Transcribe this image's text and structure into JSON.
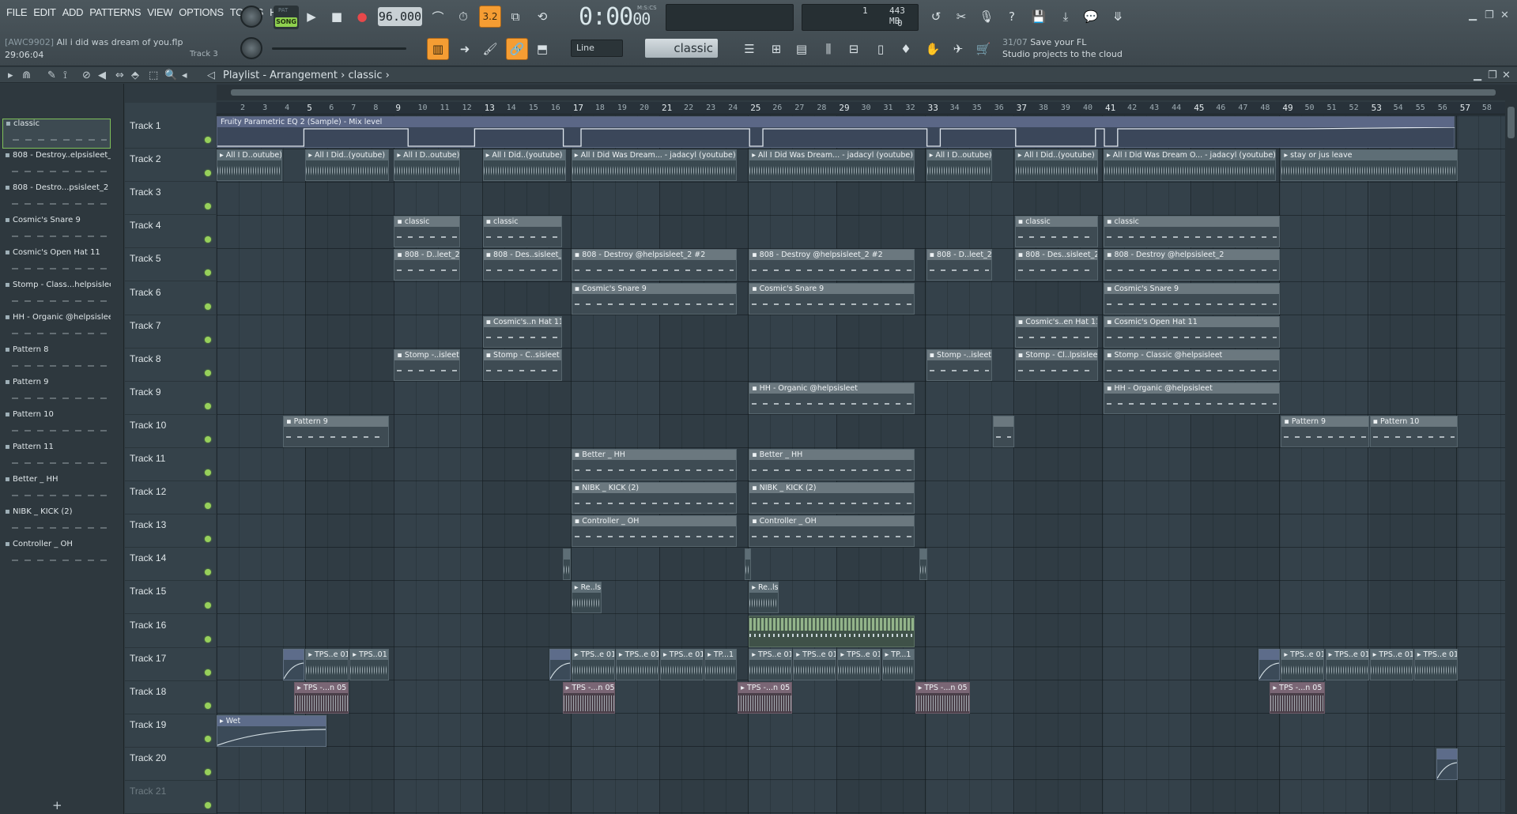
{
  "menu": [
    "FILE",
    "EDIT",
    "ADD",
    "PATTERNS",
    "VIEW",
    "OPTIONS",
    "TOOLS",
    "HELP"
  ],
  "transport": {
    "mode_pat": "PAT",
    "mode_song": "SONG",
    "tempo": "96.000",
    "time": "0:00",
    "time_small": "00",
    "time_label": "M:S:CS",
    "snap_label": "3.2"
  },
  "status": {
    "cpu_top": "1",
    "ram": "443 MB",
    "cpu_bottom": "0"
  },
  "project": {
    "tag": "[AWC9902]",
    "name": "All i did was dream of you.flp",
    "time": "29:06:04",
    "track": "Track 3"
  },
  "tool_select": {
    "line": "Line",
    "pattern": "classic"
  },
  "news": {
    "date": "31/07",
    "line1": "Save your FL",
    "line2": "Studio projects to the cloud"
  },
  "playlist": {
    "title": "Playlist - Arrangement",
    "sep": "›",
    "pattern": "classic"
  },
  "picker_items": [
    "classic",
    "808 - Destroy..elpsisleet_2",
    "808 - Destro...psisleet_2 #2",
    "Cosmic's Snare 9",
    "Cosmic's Open Hat 11",
    "Stomp - Class...helpsisleet",
    "HH - Organic @helpsisleet",
    "Pattern 8",
    "Pattern 9",
    "Pattern 10",
    "Pattern 11",
    "Better _ HH",
    "NIBK _ KICK (2)",
    "Controller _ OH"
  ],
  "tracks": [
    "Track 1",
    "Track 2",
    "Track 3",
    "Track 4",
    "Track 5",
    "Track 6",
    "Track 7",
    "Track 8",
    "Track 9",
    "Track 10",
    "Track 11",
    "Track 12",
    "Track 13",
    "Track 14",
    "Track 15",
    "Track 16",
    "Track 17",
    "Track 18",
    "Track 19",
    "Track 20",
    "Track 21"
  ],
  "ruler": [
    "2",
    "3",
    "4",
    "5",
    "6",
    "7",
    "8",
    "9",
    "10",
    "11",
    "12",
    "13",
    "14",
    "15",
    "16",
    "17",
    "18",
    "19",
    "20",
    "21",
    "22",
    "23",
    "24",
    "25",
    "26",
    "27",
    "28",
    "29",
    "30",
    "31",
    "32",
    "33",
    "34",
    "35",
    "36",
    "37",
    "38",
    "39",
    "40",
    "41",
    "42",
    "43",
    "44",
    "45",
    "46",
    "47",
    "48",
    "49",
    "50",
    "51",
    "52",
    "53",
    "54",
    "55",
    "56",
    "57",
    "58"
  ],
  "eq_lane": "Fruity Parametric EQ 2 (Sample) - Mix level",
  "clips": [
    {
      "t": 2,
      "s": 1,
      "e": 4,
      "k": "audio",
      "l": "All I D..outube)"
    },
    {
      "t": 2,
      "s": 5,
      "e": 8.8,
      "k": "audio",
      "l": "All I Did..(youtube)"
    },
    {
      "t": 2,
      "s": 9,
      "e": 12,
      "k": "audio",
      "l": "All I D..outube)"
    },
    {
      "t": 2,
      "s": 13,
      "e": 16.8,
      "k": "audio",
      "l": "All I Did..(youtube)"
    },
    {
      "t": 2,
      "s": 17,
      "e": 24.5,
      "k": "audio",
      "l": "All I Did Was Dream... - jadacyl (youtube)"
    },
    {
      "t": 2,
      "s": 25,
      "e": 32.5,
      "k": "audio",
      "l": "All I Did Was Dream... - jadacyl (youtube)"
    },
    {
      "t": 2,
      "s": 33,
      "e": 36,
      "k": "audio",
      "l": "All I D..outube)"
    },
    {
      "t": 2,
      "s": 37,
      "e": 40.8,
      "k": "audio",
      "l": "All I Did..(youtube)"
    },
    {
      "t": 2,
      "s": 41,
      "e": 48.8,
      "k": "audio",
      "l": "All I Did Was Dream O... - jadacyl (youtube)"
    },
    {
      "t": 2,
      "s": 49,
      "e": 57,
      "k": "audio",
      "l": "stay or jus leave"
    },
    {
      "t": 4,
      "s": 9,
      "e": 12,
      "k": "pat",
      "l": "classic"
    },
    {
      "t": 4,
      "s": 13,
      "e": 16.6,
      "k": "pat",
      "l": "classic"
    },
    {
      "t": 4,
      "s": 37,
      "e": 40.8,
      "k": "pat",
      "l": "classic"
    },
    {
      "t": 4,
      "s": 41,
      "e": 49,
      "k": "pat",
      "l": "classic"
    },
    {
      "t": 5,
      "s": 9,
      "e": 12,
      "k": "pat",
      "l": "808 - D..leet_2"
    },
    {
      "t": 5,
      "s": 13,
      "e": 16.6,
      "k": "pat",
      "l": "808 - Des..sisleet_2"
    },
    {
      "t": 5,
      "s": 17,
      "e": 24.5,
      "k": "pat",
      "l": "808 - Destroy @helpsisleet_2 #2"
    },
    {
      "t": 5,
      "s": 25,
      "e": 32.5,
      "k": "pat",
      "l": "808 - Destroy @helpsisleet_2 #2"
    },
    {
      "t": 5,
      "s": 33,
      "e": 36,
      "k": "pat",
      "l": "808 - D..leet_2"
    },
    {
      "t": 5,
      "s": 37,
      "e": 40.8,
      "k": "pat",
      "l": "808 - Des..sisleet_2"
    },
    {
      "t": 5,
      "s": 41,
      "e": 49,
      "k": "pat",
      "l": "808 - Destroy @helpsisleet_2"
    },
    {
      "t": 6,
      "s": 17,
      "e": 24.5,
      "k": "pat",
      "l": "Cosmic's Snare 9"
    },
    {
      "t": 6,
      "s": 25,
      "e": 32.5,
      "k": "pat",
      "l": "Cosmic's Snare 9"
    },
    {
      "t": 6,
      "s": 41,
      "e": 49,
      "k": "pat",
      "l": "Cosmic's Snare 9"
    },
    {
      "t": 7,
      "s": 13,
      "e": 16.6,
      "k": "pat",
      "l": "Cosmic's..n Hat 11"
    },
    {
      "t": 7,
      "s": 37,
      "e": 40.8,
      "k": "pat",
      "l": "Cosmic's..en Hat 11"
    },
    {
      "t": 7,
      "s": 41,
      "e": 49,
      "k": "pat",
      "l": "Cosmic's Open Hat 11"
    },
    {
      "t": 8,
      "s": 9,
      "e": 12,
      "k": "pat",
      "l": "Stomp -..isleet"
    },
    {
      "t": 8,
      "s": 13,
      "e": 16.6,
      "k": "pat",
      "l": "Stomp - C..sisleet"
    },
    {
      "t": 8,
      "s": 33,
      "e": 36,
      "k": "pat",
      "l": "Stomp -..isleet"
    },
    {
      "t": 8,
      "s": 37,
      "e": 40.8,
      "k": "pat",
      "l": "Stomp - Cl..lpsisleet"
    },
    {
      "t": 8,
      "s": 41,
      "e": 49,
      "k": "pat",
      "l": "Stomp - Classic @helpsisleet"
    },
    {
      "t": 9,
      "s": 25,
      "e": 32.5,
      "k": "pat",
      "l": "HH - Organic @helpsisleet"
    },
    {
      "t": 9,
      "s": 41,
      "e": 49,
      "k": "pat",
      "l": "HH - Organic @helpsisleet"
    },
    {
      "t": 10,
      "s": 4,
      "e": 8.8,
      "k": "pat",
      "l": "Pattern 9"
    },
    {
      "t": 10,
      "s": 36,
      "e": 37,
      "k": "pat",
      "l": ""
    },
    {
      "t": 10,
      "s": 49,
      "e": 53,
      "k": "pat",
      "l": "Pattern 9"
    },
    {
      "t": 10,
      "s": 53,
      "e": 57,
      "k": "pat",
      "l": "Pattern 10"
    },
    {
      "t": 11,
      "s": 17,
      "e": 24.5,
      "k": "pat",
      "l": "Better _ HH"
    },
    {
      "t": 11,
      "s": 25,
      "e": 32.5,
      "k": "pat",
      "l": "Better _ HH"
    },
    {
      "t": 12,
      "s": 17,
      "e": 24.5,
      "k": "pat",
      "l": "NIBK _ KICK (2)"
    },
    {
      "t": 12,
      "s": 25,
      "e": 32.5,
      "k": "pat",
      "l": "NIBK _ KICK (2)"
    },
    {
      "t": 13,
      "s": 17,
      "e": 24.5,
      "k": "pat",
      "l": "Controller _ OH"
    },
    {
      "t": 13,
      "s": 25,
      "e": 32.5,
      "k": "pat",
      "l": "Controller _ OH"
    },
    {
      "t": 14,
      "s": 16.6,
      "e": 17,
      "k": "audio",
      "l": ""
    },
    {
      "t": 14,
      "s": 24.8,
      "e": 25.1,
      "k": "audio",
      "l": ""
    },
    {
      "t": 14,
      "s": 32.7,
      "e": 33.1,
      "k": "audio",
      "l": ""
    },
    {
      "t": 15,
      "s": 17,
      "e": 18.4,
      "k": "audio",
      "l": "Re..ls"
    },
    {
      "t": 15,
      "s": 25,
      "e": 26.4,
      "k": "audio",
      "l": "Re..ls"
    },
    {
      "t": 16,
      "s": 25,
      "e": 32.5,
      "k": "green",
      "l": ""
    },
    {
      "t": 17,
      "s": 4,
      "e": 5,
      "k": "auto",
      "l": ""
    },
    {
      "t": 17,
      "s": 5,
      "e": 7,
      "k": "audio",
      "l": "TPS..e 01"
    },
    {
      "t": 17,
      "s": 7,
      "e": 8.8,
      "k": "audio",
      "l": "TPS..01"
    },
    {
      "t": 17,
      "s": 16,
      "e": 17,
      "k": "auto",
      "l": ""
    },
    {
      "t": 17,
      "s": 17,
      "e": 19,
      "k": "audio",
      "l": "TPS..e 01"
    },
    {
      "t": 17,
      "s": 19,
      "e": 21,
      "k": "audio",
      "l": "TPS..e 01"
    },
    {
      "t": 17,
      "s": 21,
      "e": 23,
      "k": "audio",
      "l": "TPS..e 01"
    },
    {
      "t": 17,
      "s": 23,
      "e": 24.5,
      "k": "audio",
      "l": "TP...1"
    },
    {
      "t": 17,
      "s": 25,
      "e": 27,
      "k": "audio",
      "l": "TPS..e 01"
    },
    {
      "t": 17,
      "s": 27,
      "e": 29,
      "k": "audio",
      "l": "TPS..e 01"
    },
    {
      "t": 17,
      "s": 29,
      "e": 31,
      "k": "audio",
      "l": "TPS..e 01"
    },
    {
      "t": 17,
      "s": 31,
      "e": 32.5,
      "k": "audio",
      "l": "TP...1"
    },
    {
      "t": 17,
      "s": 48,
      "e": 49,
      "k": "auto",
      "l": ""
    },
    {
      "t": 17,
      "s": 49,
      "e": 51,
      "k": "audio",
      "l": "TPS..e 01"
    },
    {
      "t": 17,
      "s": 51,
      "e": 53,
      "k": "audio",
      "l": "TPS..e 01"
    },
    {
      "t": 17,
      "s": 53,
      "e": 55,
      "k": "audio",
      "l": "TPS..e 01"
    },
    {
      "t": 17,
      "s": 55,
      "e": 57,
      "k": "audio",
      "l": "TPS..e 01"
    },
    {
      "t": 18,
      "s": 4.5,
      "e": 7,
      "k": "pink",
      "l": "TPS -...n 05"
    },
    {
      "t": 18,
      "s": 16.6,
      "e": 19,
      "k": "pink",
      "l": "TPS -...n 05"
    },
    {
      "t": 18,
      "s": 24.5,
      "e": 27,
      "k": "pink",
      "l": "TPS -...n 05"
    },
    {
      "t": 18,
      "s": 32.5,
      "e": 35,
      "k": "pink",
      "l": "TPS -...n 05"
    },
    {
      "t": 18,
      "s": 48.5,
      "e": 51,
      "k": "pink",
      "l": "TPS -...n 05"
    },
    {
      "t": 19,
      "s": 1,
      "e": 6,
      "k": "auto",
      "l": "Wet"
    },
    {
      "t": 20,
      "s": 56,
      "e": 57,
      "k": "auto",
      "l": ""
    }
  ]
}
